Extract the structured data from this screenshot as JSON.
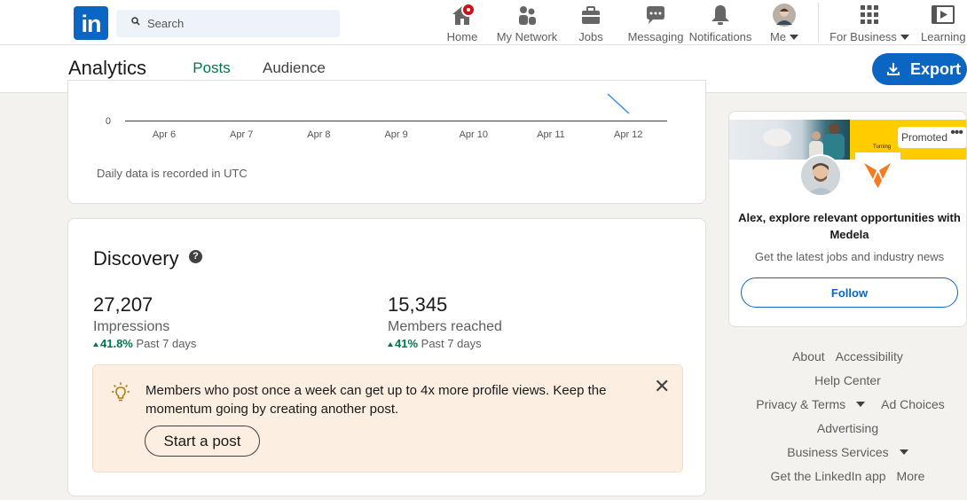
{
  "nav": {
    "logo_text": "in",
    "search_placeholder": "Search",
    "items": [
      {
        "label": "Home"
      },
      {
        "label": "My Network"
      },
      {
        "label": "Jobs"
      },
      {
        "label": "Messaging"
      },
      {
        "label": "Notifications"
      },
      {
        "label": "Me"
      },
      {
        "label": "For Business"
      },
      {
        "label": "Learning"
      }
    ]
  },
  "subheader": {
    "title": "Analytics",
    "tabs": [
      {
        "label": "Posts",
        "active": true
      },
      {
        "label": "Audience",
        "active": false
      }
    ],
    "export_label": "Export"
  },
  "chart": {
    "y_zero_label": "0",
    "x_labels": [
      "Apr 6",
      "Apr 7",
      "Apr 8",
      "Apr 9",
      "Apr 10",
      "Apr 11",
      "Apr 12"
    ],
    "note": "Daily data is recorded in UTC",
    "line_color": "#378fe9"
  },
  "discovery": {
    "title": "Discovery",
    "help_icon": "?",
    "metrics": [
      {
        "value": "27,207",
        "label": "Impressions",
        "change": "41.8%",
        "period": "Past 7 days"
      },
      {
        "value": "15,345",
        "label": "Members reached",
        "change": "41%",
        "period": "Past 7 days"
      }
    ],
    "tip": {
      "message": "Members who post once a week can get up to 4x more profile views. Keep the momentum going by creating another post.",
      "button": "Start a post",
      "close": "✕"
    }
  },
  "ad": {
    "promoted_label": "Promoted",
    "more": "•••",
    "banner_text": "Turning",
    "headline": "Alex, explore relevant opportunities with Medela",
    "subtext": "Get the latest jobs and industry news",
    "follow_label": "Follow"
  },
  "footer": {
    "about": "About",
    "accessibility": "Accessibility",
    "help_center": "Help Center",
    "privacy_terms": "Privacy & Terms",
    "ad_choices": "Ad Choices",
    "advertising": "Advertising",
    "business_services": "Business Services",
    "get_app": "Get the LinkedIn app",
    "more": "More"
  },
  "colors": {
    "brand": "#0a66c2",
    "active_tab": "#01754f",
    "tip_bg": "#fcefe1",
    "notification_badge": "#cc1016"
  }
}
